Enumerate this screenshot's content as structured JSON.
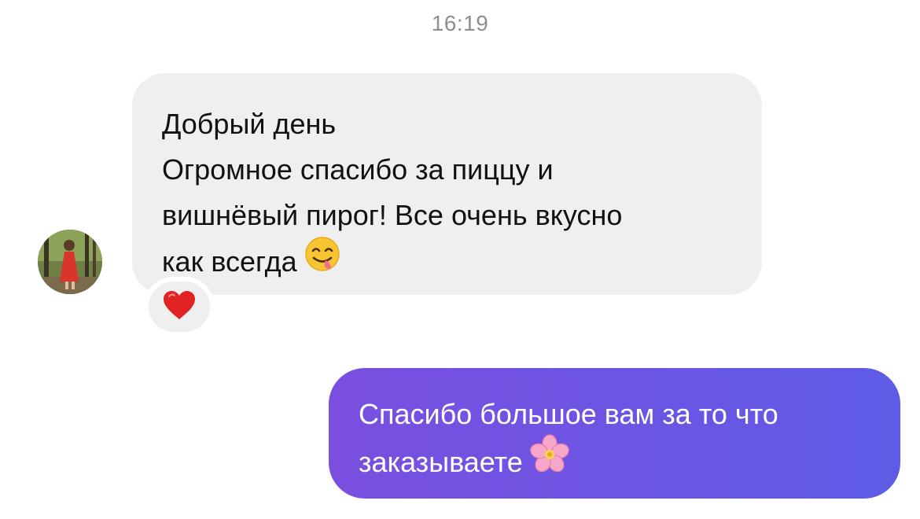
{
  "timestamp": "16:19",
  "incoming_message": {
    "lines": [
      "Добрый день",
      "Огромное спасибо за пиццу и",
      "вишнёвый пирог! Все очень вкусно",
      "как всегда"
    ],
    "emoji": "face-savoring-food",
    "reaction": "red-heart"
  },
  "outgoing_message": {
    "lines": [
      "Спасибо большое вам за то что",
      "заказываете"
    ],
    "emoji": "cherry-blossom",
    "gradient": [
      "#7a4fe0",
      "#5e5ce6"
    ]
  },
  "colors": {
    "incoming_bubble": "#efefef",
    "timestamp": "#8e8e93"
  }
}
